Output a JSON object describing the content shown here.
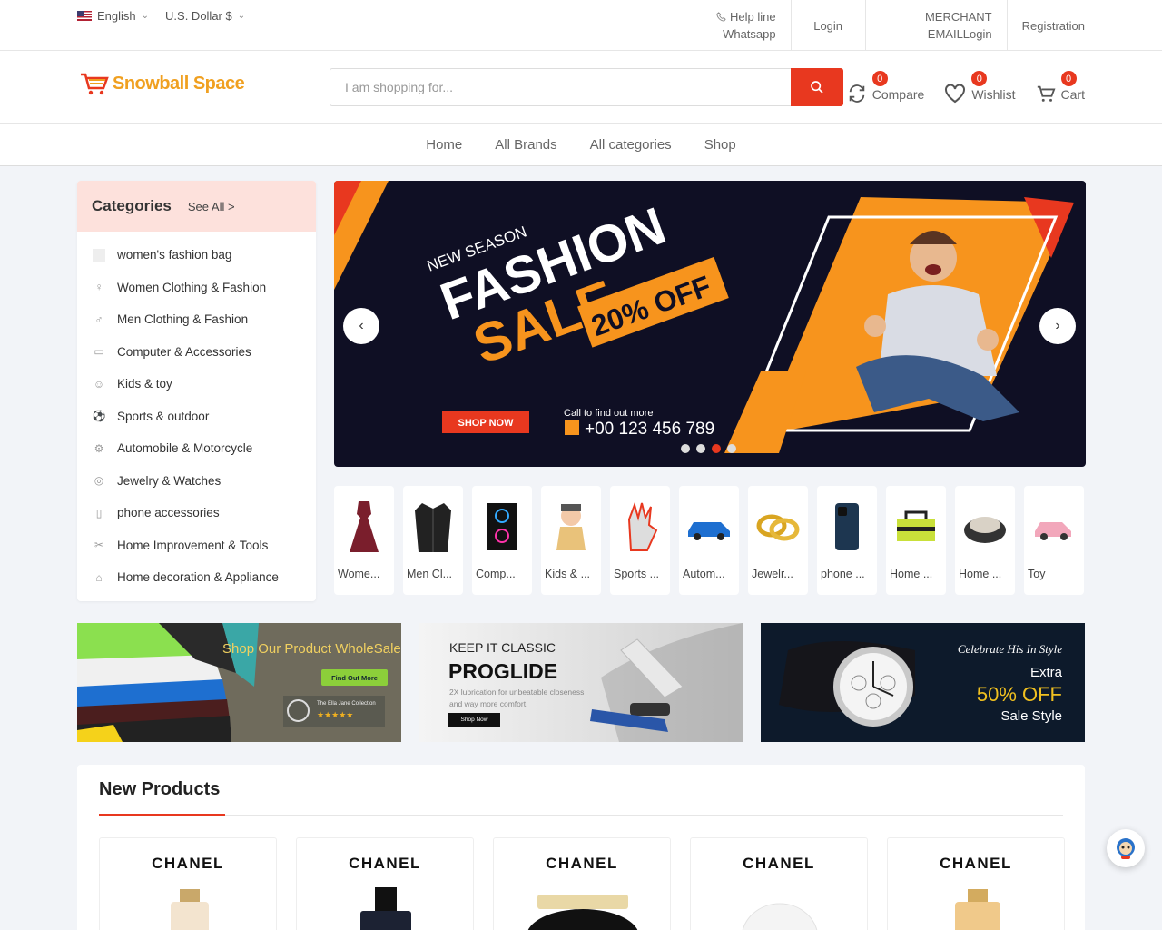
{
  "topbar": {
    "language": "English",
    "currency": "U.S. Dollar $",
    "helpline_label": "Help line",
    "whatsapp_label": "Whatsapp",
    "login": "Login",
    "merchant": "MERCHANT",
    "email_login": "EMAILLogin",
    "registration": "Registration"
  },
  "header": {
    "logo_text": "Snowball Space",
    "search_placeholder": "I am shopping for...",
    "compare": {
      "label": "Compare",
      "count": "0"
    },
    "wishlist": {
      "label": "Wishlist",
      "count": "0"
    },
    "cart": {
      "label": "Cart",
      "count": "0"
    }
  },
  "nav": [
    "Home",
    "All Brands",
    "All categories",
    "Shop"
  ],
  "categories": {
    "title": "Categories",
    "see_all": "See All >",
    "items": [
      "women's fashion bag",
      "Women Clothing & Fashion",
      "Men Clothing & Fashion",
      "Computer & Accessories",
      "Kids & toy",
      "Sports & outdoor",
      "Automobile & Motorcycle",
      "Jewelry & Watches",
      "phone accessories",
      "Home Improvement & Tools",
      "Home decoration & Appliance"
    ]
  },
  "hero": {
    "new_season": "NEW SEASON",
    "fashion": "FASHION",
    "sale": "SALE",
    "discount": "20% OFF",
    "shop_now": "SHOP NOW",
    "call_text": "Call to find out more",
    "phone": "+00 123 456 789",
    "slides": 4,
    "active_slide": 3
  },
  "mini_categories": [
    "Wome...",
    "Men Cl...",
    "Comp...",
    "Kids & ...",
    "Sports ...",
    "Autom...",
    "Jewelr...",
    "phone ...",
    "Home ...",
    "Home ...",
    "Toy"
  ],
  "promos": {
    "wholesale": {
      "title": "Shop Our Product WholeSale",
      "button": "Find Out More",
      "collection": "The Ella Jane Collection"
    },
    "proglide": {
      "kicker": "KEEP IT CLASSIC",
      "title": "PROGLIDE",
      "sub1": "2X lubrication for unbeatable closeness",
      "sub2": "and way more comfort.",
      "button": "Shop Now"
    },
    "watch": {
      "line1": "Celebrate His In Style",
      "line2": "Extra",
      "line3": "50% OFF",
      "line4": "Sale Style"
    }
  },
  "new_products": {
    "title": "New Products",
    "items": [
      "CHANEL",
      "CHANEL",
      "CHANEL",
      "CHANEL",
      "CHANEL"
    ]
  },
  "colors": {
    "accent": "#e8381f",
    "logo": "#f0a020",
    "hero_orange": "#f7941d",
    "hero_bg": "#0f0f24"
  }
}
